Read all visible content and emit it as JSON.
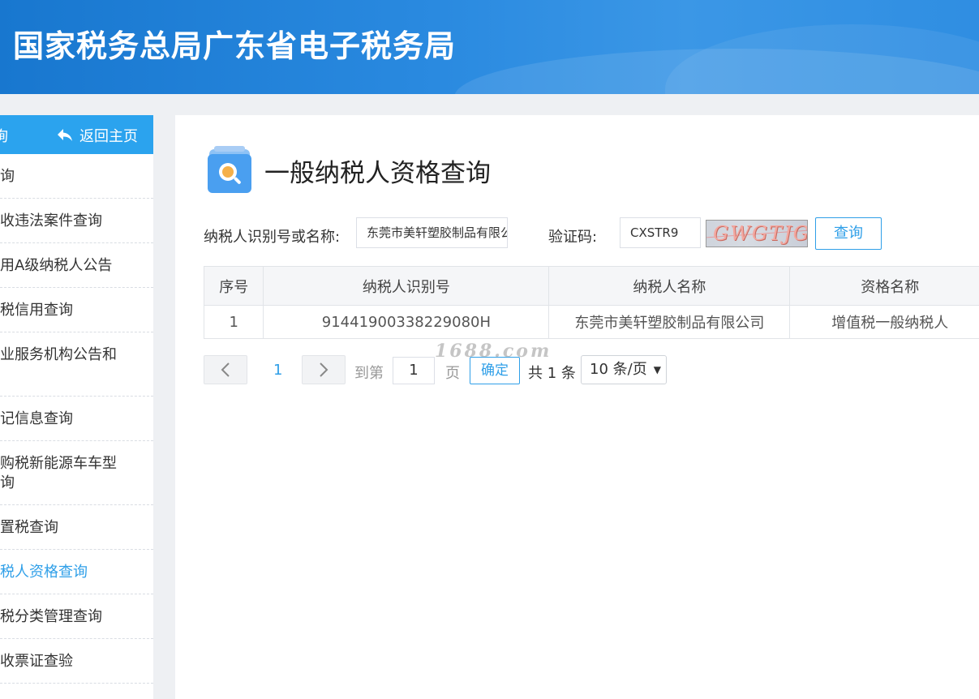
{
  "header": {
    "title": "国家税务总局广东省电子税务局"
  },
  "sidebar": {
    "head_partial": "询",
    "back_home": "返回主页",
    "items": [
      {
        "label": "查询",
        "active": false
      },
      {
        "label": "税收违法案件查询",
        "active": false
      },
      {
        "label": "信用A级纳税人公告",
        "active": false
      },
      {
        "label": "纳税信用查询",
        "active": false
      },
      {
        "label": "专业服务机构公告和\n",
        "active": false
      },
      {
        "label": "登记信息查询",
        "active": false
      },
      {
        "label": "车购税新能源车车型\n查询",
        "active": false
      },
      {
        "label": "购置税查询",
        "active": false
      },
      {
        "label": "纳税人资格查询",
        "active": true
      },
      {
        "label": "退税分类管理查询",
        "active": false
      },
      {
        "label": "税收票证查验",
        "active": false
      }
    ]
  },
  "main": {
    "title": "一般纳税人资格查询",
    "form": {
      "taxpayer_label": "纳税人识别号或名称:",
      "taxpayer_value": "东莞市美轩塑胶制品有限公",
      "captcha_label": "验证码:",
      "captcha_value": "CXSTR9",
      "captcha_image_text": "GWGTJG",
      "query_button": "查询"
    },
    "table": {
      "headers": [
        "序号",
        "纳税人识别号",
        "纳税人名称",
        "资格名称"
      ],
      "rows": [
        [
          "1",
          "91441900338229080H",
          "东莞市美轩塑胶制品有限公司",
          "增值税一般纳税人"
        ]
      ]
    },
    "pagination": {
      "current_page": "1",
      "goto_label": "到第",
      "goto_value": "1",
      "page_unit": "页",
      "confirm": "确定",
      "total": "共 1 条",
      "page_size": "10 条/页"
    },
    "watermark": "1688.com"
  }
}
